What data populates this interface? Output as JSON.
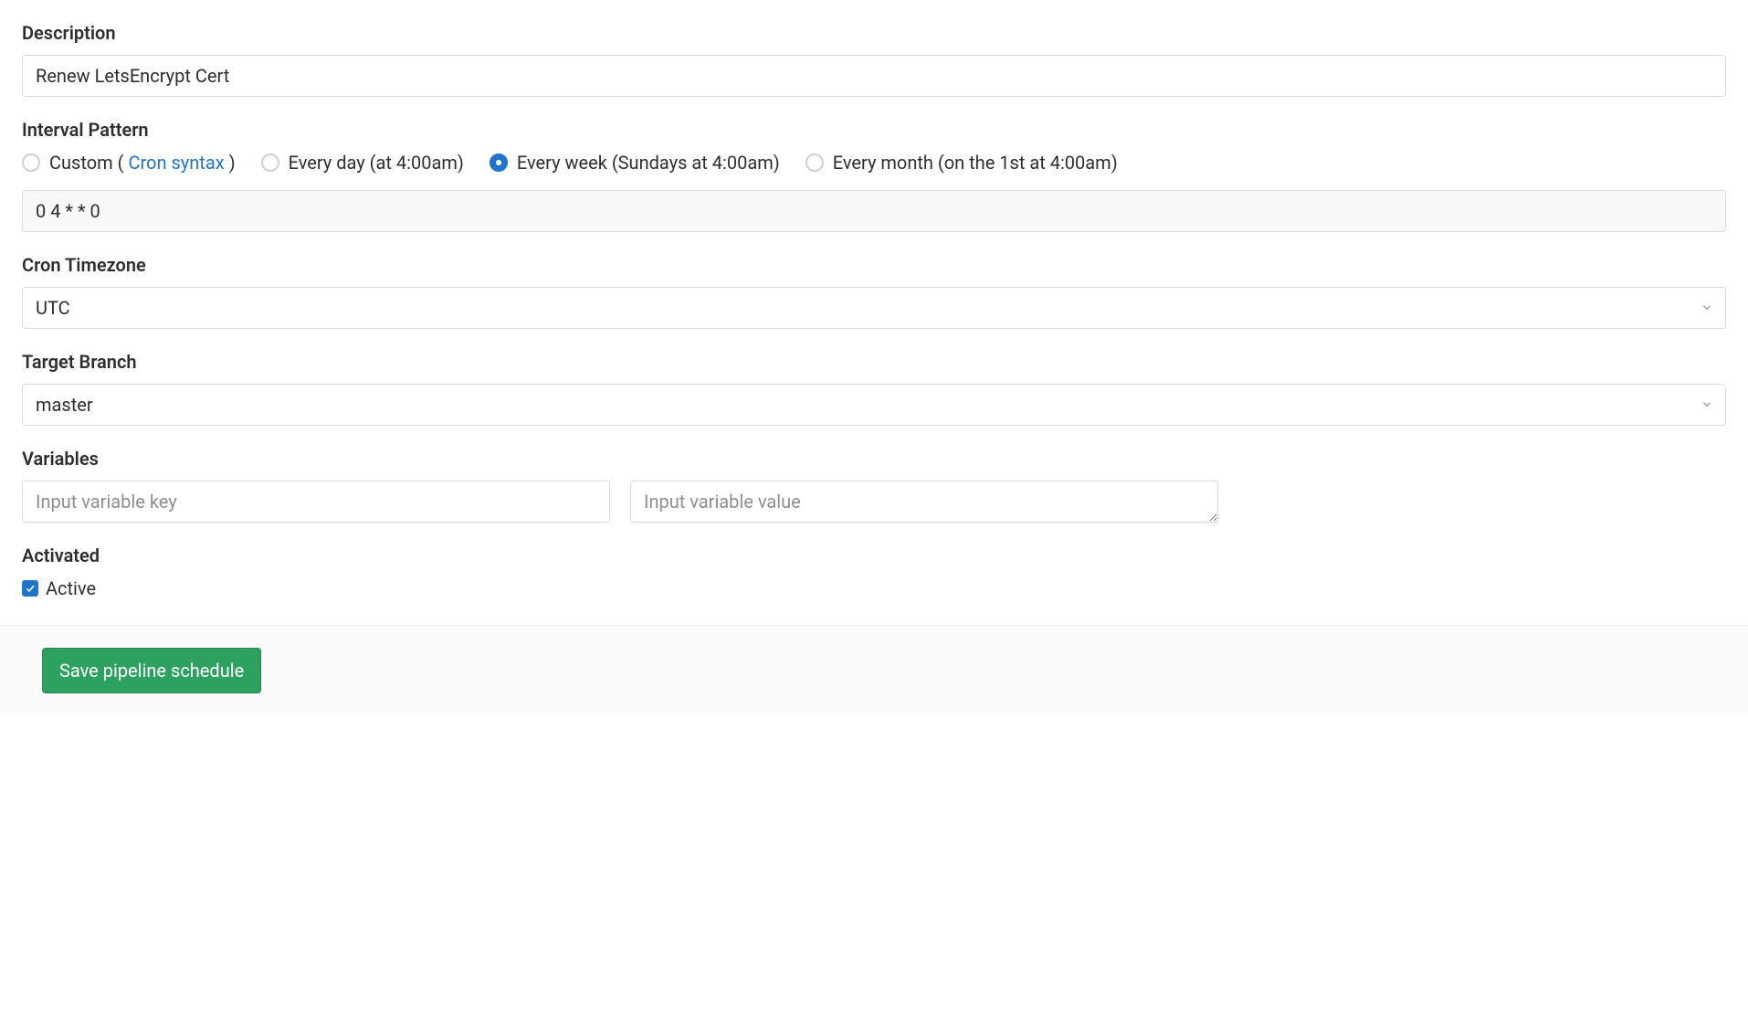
{
  "description": {
    "label": "Description",
    "value": "Renew LetsEncrypt Cert"
  },
  "interval": {
    "label": "Interval Pattern",
    "options": {
      "custom_prefix": "Custom",
      "cron_link": "Cron syntax",
      "daily": "Every day (at 4:00am)",
      "weekly": "Every week (Sundays at 4:00am)",
      "monthly": "Every month (on the 1st at 4:00am)"
    },
    "cron_value": "0 4 * * 0"
  },
  "timezone": {
    "label": "Cron Timezone",
    "value": "UTC"
  },
  "branch": {
    "label": "Target Branch",
    "value": "master"
  },
  "variables": {
    "label": "Variables",
    "key_placeholder": "Input variable key",
    "value_placeholder": "Input variable value"
  },
  "activated": {
    "label": "Activated",
    "checkbox_label": "Active",
    "checked": true
  },
  "save_button": "Save pipeline schedule"
}
